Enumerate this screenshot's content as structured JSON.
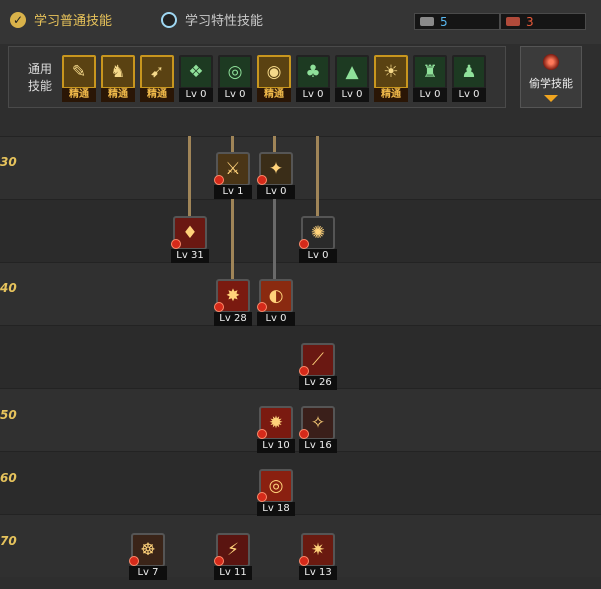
{
  "tabs": [
    {
      "label": "学习普通技能",
      "check": "✓",
      "active": true
    },
    {
      "label": "学习特性技能",
      "active": false
    }
  ],
  "counters": [
    {
      "icon": "sp-book-icon",
      "value": "5",
      "color": "#5ab8f0"
    },
    {
      "icon": "tp-book-icon",
      "value": "3",
      "color": "#e85a3a"
    }
  ],
  "common": {
    "label": "通用技能",
    "skills": [
      {
        "icon": "sitting-rest-icon",
        "glyph": "✎",
        "level": "精通",
        "mastered": true
      },
      {
        "icon": "lift-object-icon",
        "glyph": "♞",
        "level": "精通",
        "mastered": true
      },
      {
        "icon": "running-icon",
        "glyph": "➹",
        "level": "精通",
        "mastered": true
      },
      {
        "icon": "wings-icon",
        "glyph": "❖",
        "level": "Lv 0",
        "mastered": false
      },
      {
        "icon": "target-icon",
        "glyph": "◎",
        "level": "Lv 0",
        "mastered": false
      },
      {
        "icon": "target-gold-icon",
        "glyph": "◉",
        "level": "精通",
        "mastered": true
      },
      {
        "icon": "creature-icon",
        "glyph": "♣",
        "level": "Lv 0",
        "mastered": false
      },
      {
        "icon": "mountain-icon",
        "glyph": "▲",
        "level": "Lv 0",
        "mastered": false
      },
      {
        "icon": "eye-swirl-icon",
        "glyph": "☀",
        "level": "精通",
        "mastered": true
      },
      {
        "icon": "strong-man-icon",
        "glyph": "♜",
        "level": "Lv 0",
        "mastered": false
      },
      {
        "icon": "figure-icon",
        "glyph": "♟",
        "level": "Lv 0",
        "mastered": false
      }
    ]
  },
  "steal": {
    "label": "偷学技能",
    "icon": "steal-icon"
  },
  "levels": [
    "30",
    "40",
    "50",
    "60",
    "70"
  ],
  "nodes": [
    {
      "name": "skill-slash",
      "glyph": "⚔",
      "level": "Lv 1",
      "bg": "#4a3516"
    },
    {
      "name": "skill-strike",
      "glyph": "✦",
      "level": "Lv 0",
      "bg": "#3a2d18"
    },
    {
      "name": "skill-blade-red",
      "glyph": "♦",
      "level": "Lv 31",
      "bg": "#6a1812"
    },
    {
      "name": "skill-ring",
      "glyph": "✺",
      "level": "Lv 0",
      "bg": "#2a2a2a"
    },
    {
      "name": "skill-burst",
      "glyph": "✸",
      "level": "Lv 28",
      "bg": "#7a1a10"
    },
    {
      "name": "skill-moon",
      "glyph": "◐",
      "level": "Lv 0",
      "bg": "#8a2a10"
    },
    {
      "name": "skill-claws",
      "glyph": "⟋",
      "level": "Lv 26",
      "bg": "#6a1812"
    },
    {
      "name": "skill-explosion",
      "glyph": "✹",
      "level": "Lv 10",
      "bg": "#7a1a10"
    },
    {
      "name": "skill-stars",
      "glyph": "✧",
      "level": "Lv 16",
      "bg": "#3a1f1a"
    },
    {
      "name": "skill-vortex",
      "glyph": "◎",
      "level": "Lv 18",
      "bg": "#8a2010"
    },
    {
      "name": "skill-eye-sigil",
      "glyph": "☸",
      "level": "Lv 7",
      "bg": "#3a2418"
    },
    {
      "name": "skill-chains",
      "glyph": "⚡",
      "level": "Lv 11",
      "bg": "#5a1410"
    },
    {
      "name": "skill-eruption",
      "glyph": "✷",
      "level": "Lv 13",
      "bg": "#6a1a10"
    }
  ]
}
